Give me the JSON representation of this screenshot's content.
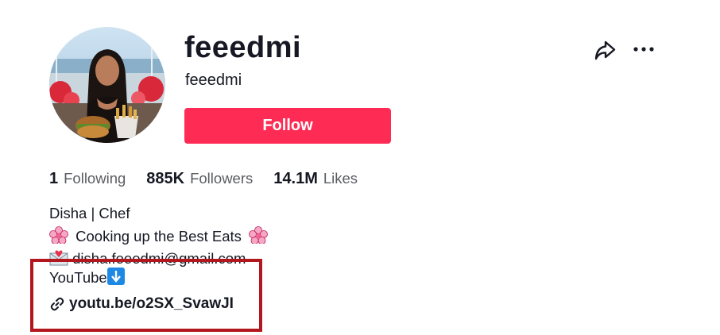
{
  "profile": {
    "username": "feeedmi",
    "nickname": "feeedmi",
    "follow_label": "Follow",
    "avatar_icon": "profile-photo"
  },
  "header_actions": {
    "share_icon": "share-arrow-icon",
    "more_icon": "more-dots-icon"
  },
  "stats": [
    {
      "count": "1",
      "label": "Following"
    },
    {
      "count": "885K",
      "label": "Followers"
    },
    {
      "count": "14.1M",
      "label": "Likes"
    }
  ],
  "bio": {
    "line1": "Disha | Chef",
    "line2": "Cooking up the Best Eats",
    "line2_emoji": "cherry-blossom",
    "line3": "disha.feeedmi@gmail.com",
    "line3_emoji": "envelope-with-heart",
    "line4": "YouTube",
    "line4_emoji": "down-arrow-button"
  },
  "link": {
    "text": "youtu.be/o2SX_SvawJI",
    "icon": "link-icon"
  },
  "colors": {
    "accent": "#fe2c55",
    "highlight_border": "#b2171e",
    "text": "#161823",
    "muted": "#5b5c63"
  }
}
